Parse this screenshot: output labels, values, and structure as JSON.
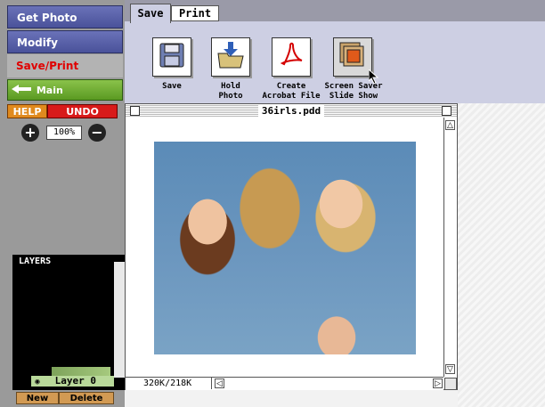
{
  "sidebar": {
    "nav": [
      {
        "label": "Get Photo"
      },
      {
        "label": "Modify"
      },
      {
        "label": "Save/Print"
      },
      {
        "label": "Main"
      }
    ],
    "help_label": "HELP",
    "undo_label": "UNDO",
    "zoom_value": "100%",
    "layers": {
      "title": "LAYERS",
      "layer_name": "Layer 0",
      "new_label": "New",
      "delete_label": "Delete"
    }
  },
  "tabs": [
    {
      "label": "Save",
      "active": true
    },
    {
      "label": "Print",
      "active": false
    }
  ],
  "tools": [
    {
      "label_line1": "Save",
      "label_line2": "",
      "icon": "floppy-disk-icon"
    },
    {
      "label_line1": "Hold",
      "label_line2": "Photo",
      "icon": "folder-download-icon"
    },
    {
      "label_line1": "Create",
      "label_line2": "Acrobat File",
      "icon": "acrobat-icon"
    },
    {
      "label_line1": "Screen Saver",
      "label_line2": "Slide Show",
      "icon": "slideshow-icon"
    }
  ],
  "document": {
    "title": "36irls.pdd",
    "size_readout": "320K/218K"
  },
  "colors": {
    "nav_blue": "#4a529a",
    "save_print_red": "#e00000",
    "main_green": "#5a9a22",
    "help_orange": "#e08a1e",
    "undo_red": "#d81a1a"
  }
}
